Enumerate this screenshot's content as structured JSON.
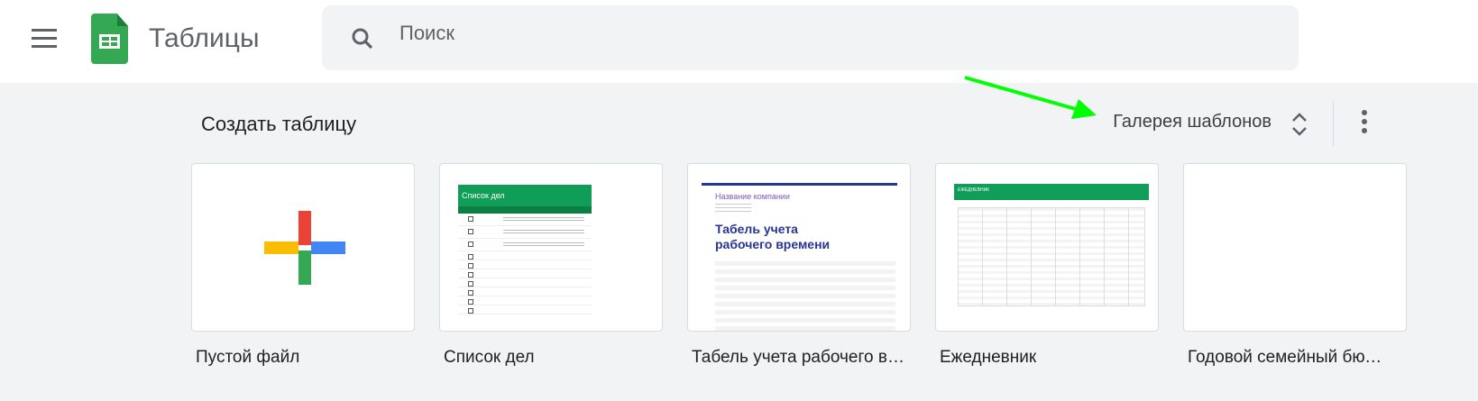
{
  "header": {
    "app_title": "Таблицы",
    "search_placeholder": "Поиск"
  },
  "toolbar": {
    "title": "Создать таблицу",
    "gallery_label": "Галерея шаблонов"
  },
  "templates": [
    {
      "label": "Пустой файл"
    },
    {
      "label": "Список дел",
      "thumb_title": "Список дел"
    },
    {
      "label": "Табель учета рабочего времени",
      "thumb_company": "Название компании",
      "thumb_title": "Табель учета рабочего времени"
    },
    {
      "label": "Ежедневник",
      "thumb_title": "ЕЖЕДНЕВНИК"
    },
    {
      "label": "Годовой семейный бюджет"
    }
  ],
  "colors": {
    "accent": "#34a853",
    "annotation_arrow": "#00ff00"
  }
}
